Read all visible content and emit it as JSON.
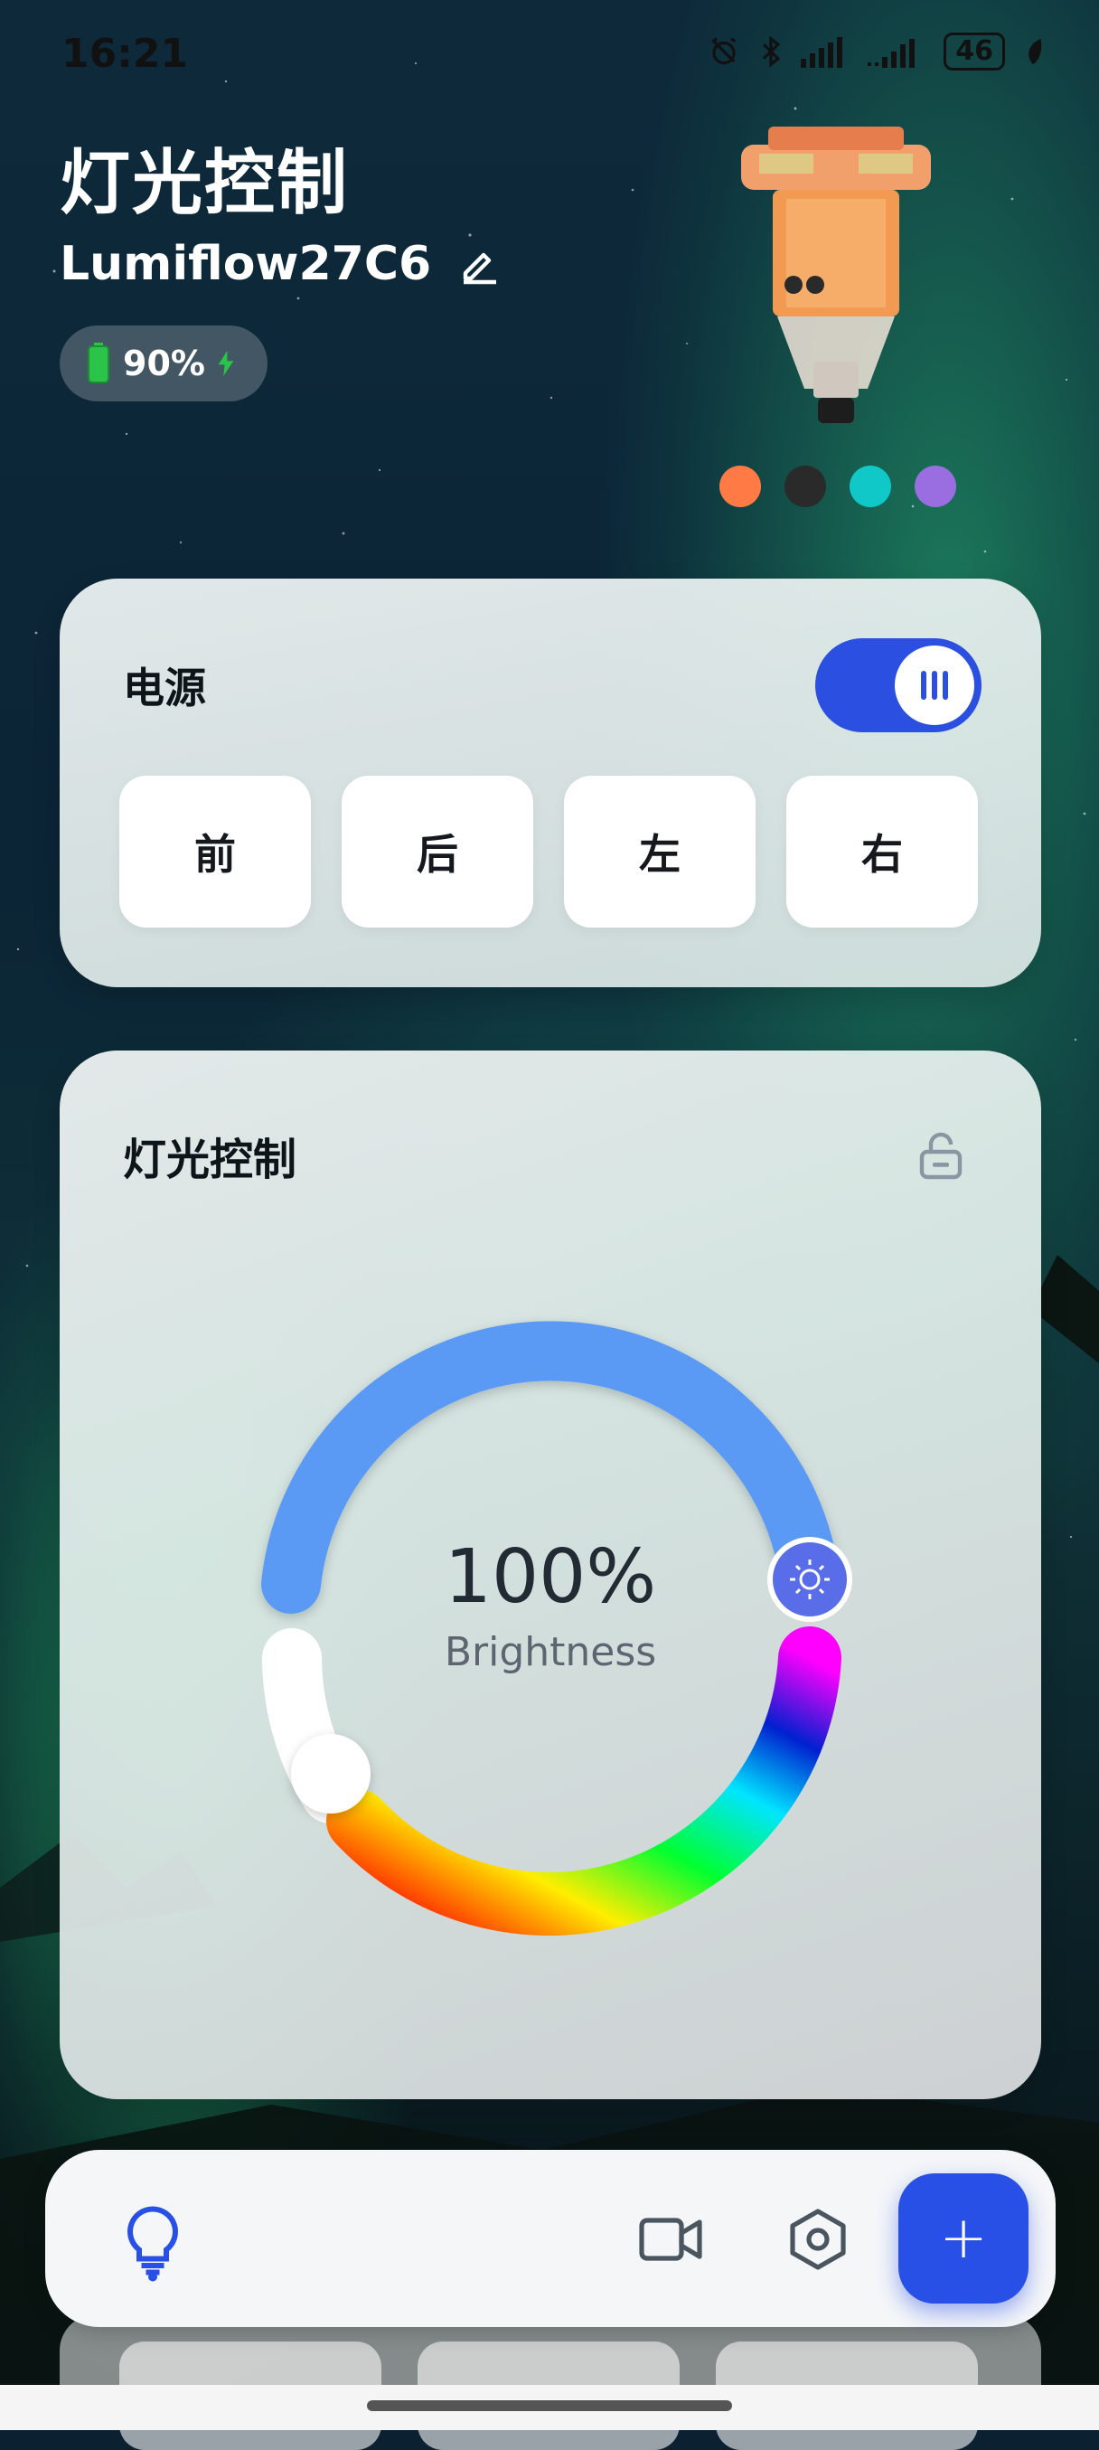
{
  "status_bar": {
    "time": "16:21",
    "battery": "46"
  },
  "header": {
    "title": "灯光控制",
    "device_name": "Lumiflow27C6",
    "battery_level": "90%"
  },
  "color_swatches": [
    "#ff7a45",
    "#2a2a2a",
    "#10c8c8",
    "#9a6ee0"
  ],
  "power_card": {
    "title": "电源",
    "power_on": true,
    "directions": [
      "前",
      "后",
      "左",
      "右"
    ]
  },
  "light_card": {
    "title": "灯光控制",
    "brightness_value": "100%",
    "brightness_label": "Brightness"
  },
  "bottom_nav": {
    "items": [
      "lightbulb-icon",
      "video-camera-icon",
      "hexagon-settings-icon"
    ],
    "fab_label": "+"
  },
  "colors": {
    "accent": "#2850e6",
    "brightness_arc": "#5a9af5"
  }
}
